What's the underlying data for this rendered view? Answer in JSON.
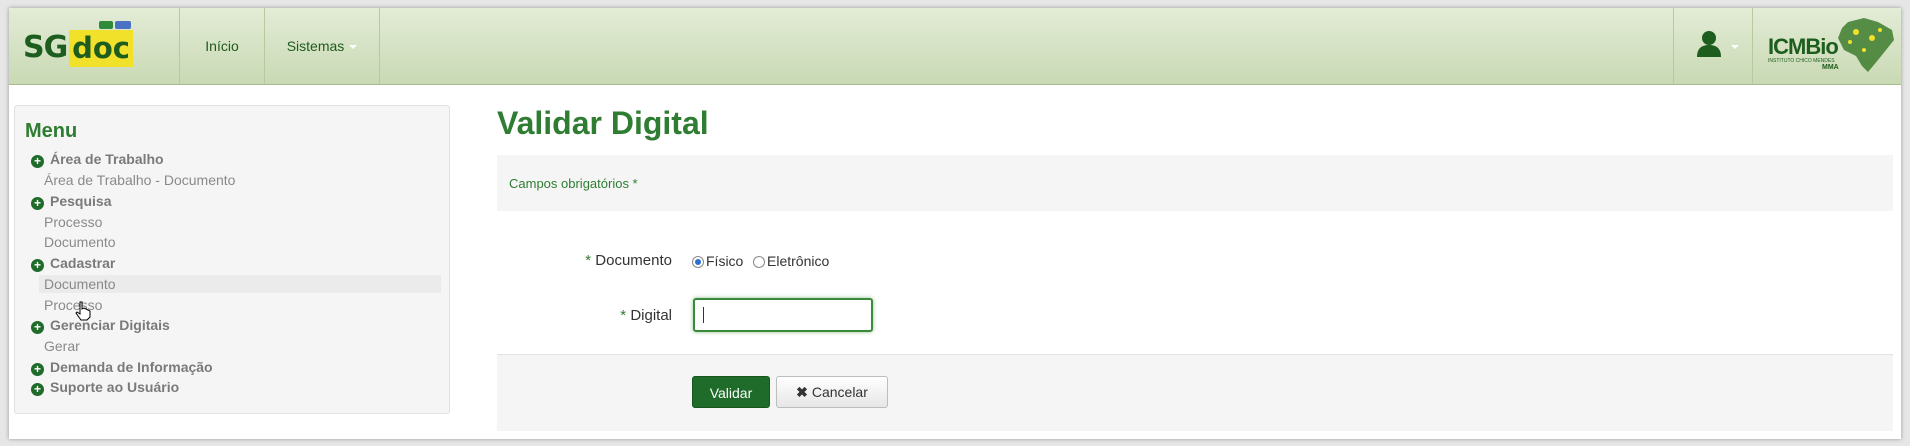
{
  "navbar": {
    "logo_sg": "SG",
    "logo_doc": "doc",
    "inicio": "Início",
    "sistemas": "Sistemas",
    "org_logo": "ICMBio",
    "org_sub": "INSTITUTO CHICO MENDES",
    "org_mma": "MMA"
  },
  "menu": {
    "title": "Menu",
    "items": [
      {
        "type": "head",
        "label": "Área de Trabalho"
      },
      {
        "type": "sub",
        "label": "Área de Trabalho - Documento"
      },
      {
        "type": "head",
        "label": "Pesquisa"
      },
      {
        "type": "sub",
        "label": "Processo"
      },
      {
        "type": "sub",
        "label": "Documento"
      },
      {
        "type": "head",
        "label": "Cadastrar"
      },
      {
        "type": "sub",
        "label": "Documento"
      },
      {
        "type": "sub",
        "label": "Processo"
      },
      {
        "type": "head",
        "label": "Gerenciar Digitais"
      },
      {
        "type": "sub",
        "label": "Gerar"
      },
      {
        "type": "head",
        "label": "Demanda de Informação"
      },
      {
        "type": "head",
        "label": "Suporte ao Usuário"
      }
    ]
  },
  "main": {
    "title": "Validar Digital",
    "required_note": "Campos obrigatórios *",
    "documento_label": "Documento",
    "required_mark": "*",
    "radio_fisico": "Físico",
    "radio_eletronico": "Eletrônico",
    "selected_option": "Físico",
    "digital_label": "Digital",
    "digital_value": "",
    "btn_validar": "Validar",
    "btn_cancelar": "Cancelar"
  },
  "colors": {
    "primary_green": "#2e7d32",
    "button_green": "#1e6b2a",
    "logo_yellow": "#f2e12b"
  },
  "icons": [
    "user-icon",
    "plus-circle-icon",
    "close-icon",
    "hand-pointer-icon"
  ]
}
